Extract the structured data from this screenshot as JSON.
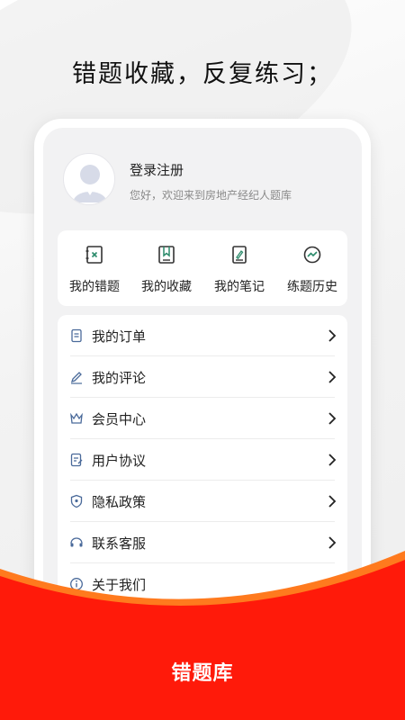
{
  "headline": "错题收藏，反复练习；",
  "profile": {
    "login_label": "登录注册",
    "welcome": "您好，欢迎来到房地产经纪人题库"
  },
  "quick_actions": [
    {
      "label": "我的错题",
      "icon": "wrong-questions-icon"
    },
    {
      "label": "我的收藏",
      "icon": "bookmark-icon"
    },
    {
      "label": "我的笔记",
      "icon": "notes-icon"
    },
    {
      "label": "练题历史",
      "icon": "history-chart-icon"
    }
  ],
  "menu": [
    {
      "label": "我的订单",
      "icon": "order-icon"
    },
    {
      "label": "我的评论",
      "icon": "comment-pen-icon"
    },
    {
      "label": "会员中心",
      "icon": "crown-icon"
    },
    {
      "label": "用户协议",
      "icon": "agreement-icon"
    },
    {
      "label": "隐私政策",
      "icon": "shield-icon"
    },
    {
      "label": "联系客服",
      "icon": "headset-icon"
    },
    {
      "label": "关于我们",
      "icon": "info-icon"
    }
  ],
  "brand": "错题库",
  "colors": {
    "accent_red": "#ff1a0a",
    "accent_orange": "#ff6a1a",
    "icon_blue": "#4a6a9a",
    "icon_green": "#2a8a6a"
  }
}
